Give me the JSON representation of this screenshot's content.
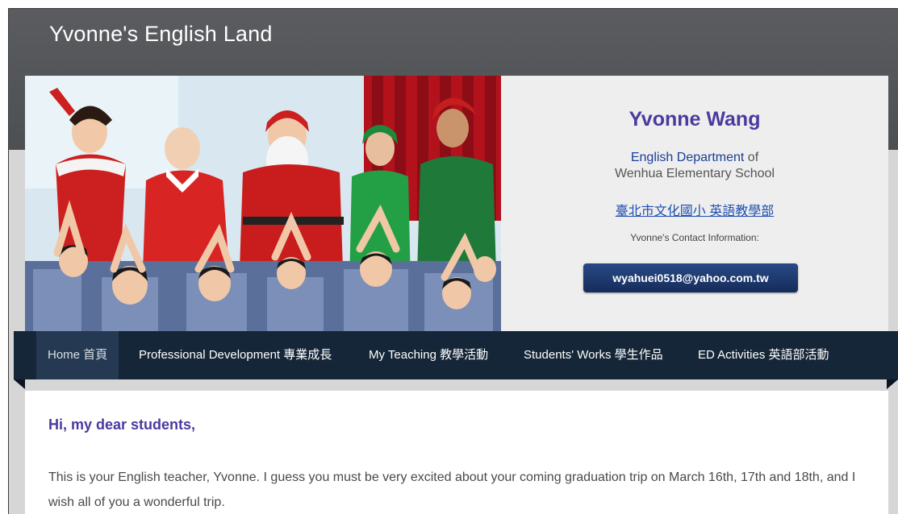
{
  "site": {
    "title": "Yvonne's English Land"
  },
  "profile": {
    "name": "Yvonne Wang",
    "dept_line1_blue": "English Department",
    "dept_line1_rest": " of",
    "dept_line2": "Wenhua Elementary School",
    "chinese_link": "臺北市文化國小 英語教學部",
    "contact_label": "Yvonne's Contact Information:",
    "email": "wyahuei0518@yahoo.com.tw"
  },
  "nav": {
    "items": [
      {
        "label": "Home 首頁",
        "active": true
      },
      {
        "label": "Professional Development 專業成長",
        "active": false
      },
      {
        "label": "My Teaching 教學活動",
        "active": false
      },
      {
        "label": "Students' Works 學生作品",
        "active": false
      },
      {
        "label": "ED Activities 英語部活動",
        "active": false
      }
    ]
  },
  "content": {
    "greeting": "Hi, my dear students,",
    "paragraph": "This is your English teacher, Yvonne. I guess you must be very excited about your coming graduation trip on March 16th, 17th and 18th, and I wish all of you a wonderful trip."
  },
  "colors": {
    "topbar": "#555759",
    "nav": "#152638",
    "accent_purple": "#4a3aa0",
    "email_button": "#1e3a70"
  }
}
